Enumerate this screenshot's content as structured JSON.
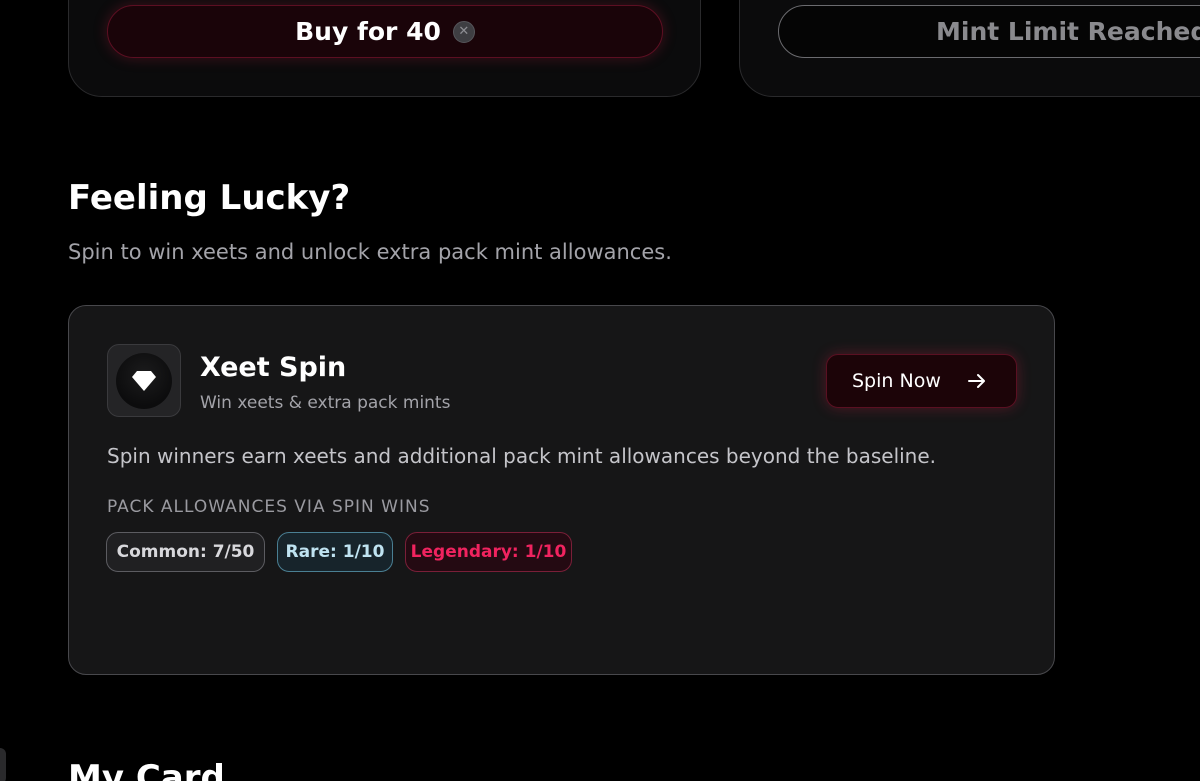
{
  "packs": {
    "buy_label": "Buy for 40",
    "coin_icon": "xeet-coin-icon",
    "limit_label": "Mint Limit Reached"
  },
  "lucky": {
    "title": "Feeling Lucky?",
    "subtitle": "Spin to win xeets and unlock extra pack mint allowances."
  },
  "spin": {
    "icon": "diamond-icon",
    "title": "Xeet Spin",
    "tagline": "Win xeets & extra pack mints",
    "button_label": "Spin Now",
    "button_icon": "arrow-right-icon",
    "description": "Spin winners earn xeets and additional pack mint allowances beyond the baseline.",
    "allowances_heading": "PACK ALLOWANCES VIA SPIN WINS",
    "allowances": [
      {
        "label": "Common: 7/50",
        "color": "#d8d8dc"
      },
      {
        "label": "Rare: 1/10",
        "color": "#bfe3f1"
      },
      {
        "label": "Legendary: 1/10",
        "color": "#f0235f"
      }
    ]
  },
  "my_card": {
    "title": "My Card"
  },
  "colors": {
    "background": "#000000",
    "card": "#161617",
    "accent": "#f0235f"
  }
}
